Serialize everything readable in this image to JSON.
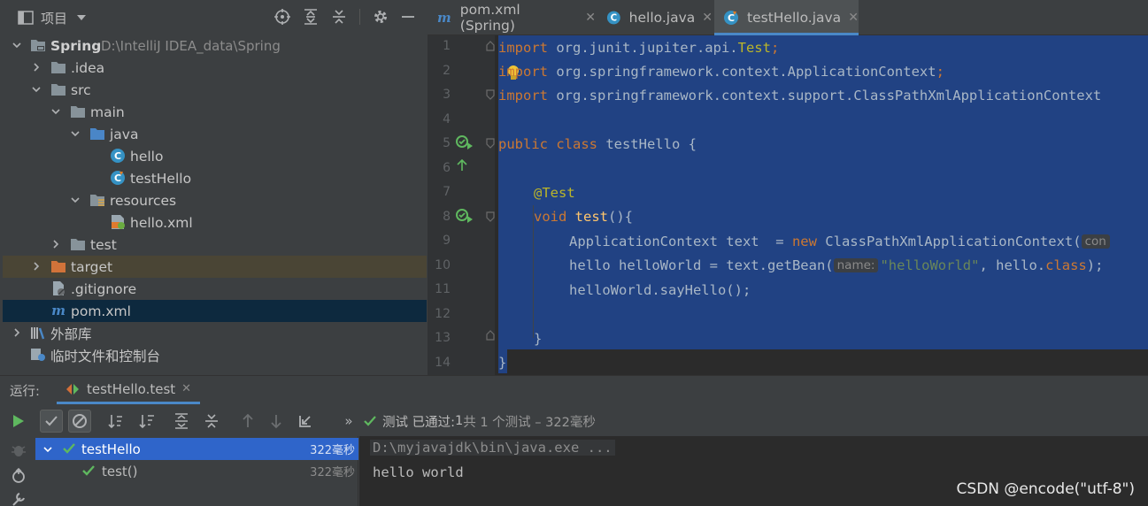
{
  "project_panel": {
    "title": "项目",
    "tree": [
      {
        "label": "Spring",
        "path": "D:\\IntelliJ IDEA_data\\Spring"
      },
      {
        "label": ".idea"
      },
      {
        "label": "src"
      },
      {
        "label": "main"
      },
      {
        "label": "java"
      },
      {
        "label": "hello"
      },
      {
        "label": "testHello"
      },
      {
        "label": "resources"
      },
      {
        "label": "hello.xml"
      },
      {
        "label": "test"
      },
      {
        "label": "target"
      },
      {
        "label": ".gitignore"
      },
      {
        "label": "pom.xml"
      },
      {
        "label": "外部库"
      },
      {
        "label": "临时文件和控制台"
      }
    ]
  },
  "editor": {
    "tabs": [
      {
        "label": "pom.xml (Spring)"
      },
      {
        "label": "hello.java"
      },
      {
        "label": "testHello.java"
      }
    ],
    "line_numbers": [
      "1",
      "2",
      "3",
      "4",
      "5",
      "6",
      "7",
      "8",
      "9",
      "10",
      "11",
      "12",
      "13",
      "14"
    ],
    "code": {
      "l1_kw": "import",
      "l1_rest": " org.junit.jupiter.api.",
      "l1_cls": "Test",
      "l1_end": ";",
      "l2_kw": "import",
      "l2_rest": " org.springframework.context.ApplicationContext",
      "l2_end": ";",
      "l3_kw": "import",
      "l3_rest": " org.springframework.context.support.ClassPathXmlApplicationContext",
      "l5_kw": "public class",
      "l5_rest": " testHello {",
      "l7_ann": "@Test",
      "l8_kw": "void",
      "l8_fn": " test",
      "l8_rest": "(){",
      "l9_a": "ApplicationContext text  = ",
      "l9_kw": "new",
      "l9_b": " ClassPathXmlApplicationContext(",
      "l9_hint": "con",
      "l10_a": "hello helloWorld = text.getBean(",
      "l10_hint": "name:",
      "l10_str": "\"helloWorld\"",
      "l10_b": ", hello.",
      "l10_kw": "class",
      "l10_c": ");",
      "l11": "helloWorld.sayHello();",
      "l13": "}",
      "l14": "}"
    }
  },
  "run_panel": {
    "label": "运行:",
    "tab_label": "testHello.test",
    "status_prefix": "测试 已通过: ",
    "status_count": "1",
    "status_suffix": "共 1 个测试 – 322毫秒",
    "tests": [
      {
        "name": "testHello",
        "time": "322毫秒",
        "passed": true
      },
      {
        "name": "test()",
        "time": "322毫秒",
        "passed": true
      }
    ],
    "console": [
      "D:\\myjavajdk\\bin\\java.exe ...",
      "hello world"
    ]
  },
  "watermark": "CSDN @encode(\"utf-8\")",
  "colors": {
    "selection": "#214283",
    "accent": "#4a88c7",
    "pass_green": "#5fb85f",
    "keyword": "#cc7832",
    "annotation": "#bbb529",
    "string": "#6a8759"
  }
}
